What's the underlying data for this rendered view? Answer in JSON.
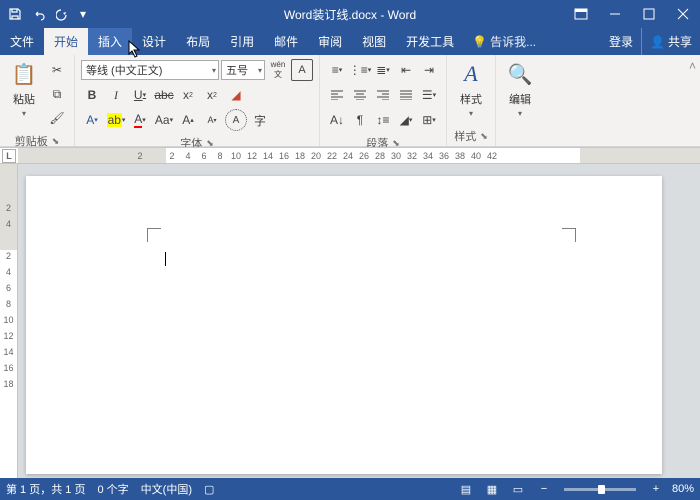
{
  "title": "Word装订线.docx - Word",
  "tabs": {
    "file": "文件",
    "home": "开始",
    "insert": "插入",
    "design": "设计",
    "layout": "布局",
    "references": "引用",
    "mailings": "邮件",
    "review": "审阅",
    "view": "视图",
    "developer": "开发工具",
    "tellme": "告诉我...",
    "login": "登录",
    "share": "共享"
  },
  "ribbon": {
    "clipboard": {
      "label": "剪贴板",
      "paste": "粘贴"
    },
    "font": {
      "label": "字体",
      "family": "等线 (中文正文)",
      "size": "五号",
      "phonetic": "wén"
    },
    "paragraph": {
      "label": "段落"
    },
    "styles": {
      "label": "样式",
      "btn": "样式"
    },
    "editing": {
      "label": "编辑",
      "btn": "编辑"
    }
  },
  "status": {
    "page": "第 1 页，共 1 页",
    "words": "0 个字",
    "lang": "中文(中国)",
    "zoom": "80%"
  },
  "ruler": {
    "nums": [
      "2",
      "",
      "2",
      "4",
      "6",
      "8",
      "10",
      "12",
      "14",
      "16",
      "18",
      "20",
      "22",
      "24",
      "26",
      "28",
      "30",
      "32",
      "34",
      "36",
      "38",
      "40",
      "42"
    ],
    "vnums": [
      "",
      "2",
      "4",
      "",
      "2",
      "4",
      "6",
      "8",
      "10",
      "12",
      "14",
      "16",
      "18"
    ]
  }
}
